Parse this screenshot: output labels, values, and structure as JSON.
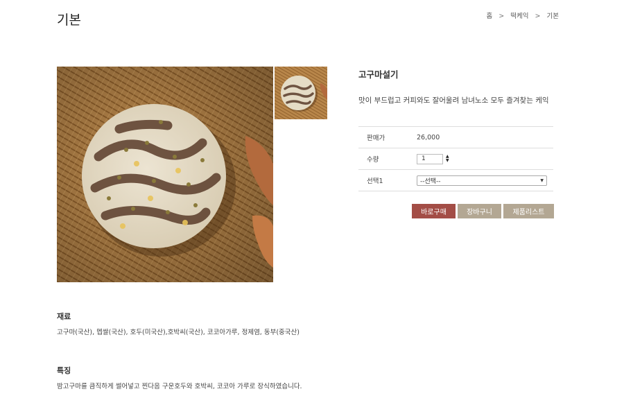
{
  "header": {
    "title": "기본",
    "breadcrumb": [
      "홈",
      "떡케익",
      "기본"
    ],
    "breadcrumb_sep": ">"
  },
  "product": {
    "name": "고구마설기",
    "description": "맛이 부드럽고 커피와도 잘어울려 남녀노소 모두 즐겨찾는 케익",
    "price_label": "판매가",
    "price": "26,000",
    "qty_label": "수량",
    "qty_value": "1",
    "option_label": "선택1",
    "option_selected": "--선택--"
  },
  "buttons": {
    "buy": "바로구매",
    "cart": "장바구니",
    "list": "제품리스트"
  },
  "sections": {
    "ingredients_title": "재료",
    "ingredients_text": "고구마(국산), 멥쌀(국산), 호두(미국산),호박씨(국산), 코코아가루, 정제염, 동부(중국산)",
    "features_title": "특징",
    "features_text": "밤고구마를 큼직하게 썰어넣고 찐다음 구운호두와 호박씨, 코코아 가루로 장식하였습니다."
  },
  "colors": {
    "buy_button": "#a34d46",
    "secondary_button": "#b3a793"
  }
}
